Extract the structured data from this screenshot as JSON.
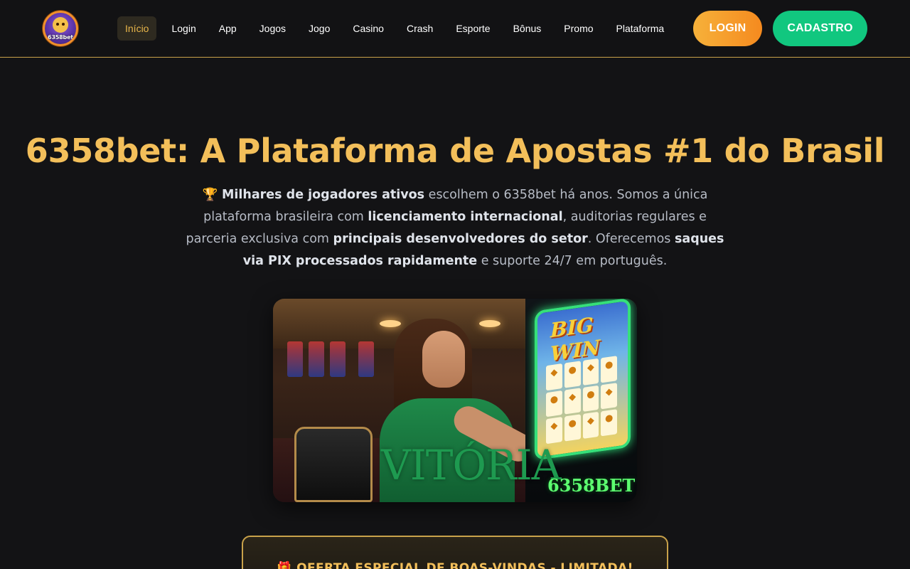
{
  "header": {
    "logo_text": "6358bet",
    "nav": [
      {
        "label": "Início",
        "active": true
      },
      {
        "label": "Login",
        "active": false
      },
      {
        "label": "App",
        "active": false
      },
      {
        "label": "Jogos",
        "active": false
      },
      {
        "label": "Jogo",
        "active": false
      },
      {
        "label": "Casino",
        "active": false
      },
      {
        "label": "Crash",
        "active": false
      },
      {
        "label": "Esporte",
        "active": false
      },
      {
        "label": "Bônus",
        "active": false
      },
      {
        "label": "Promo",
        "active": false
      },
      {
        "label": "Plataforma",
        "active": false
      }
    ],
    "login_label": "LOGIN",
    "register_label": "CADASTRO"
  },
  "hero": {
    "title": "6358bet: A Plataforma de Apostas #1 do Brasil",
    "trophy_icon": "🏆",
    "p1_bold": "Milhares de jogadores ativos",
    "p2": " escolhem o 6358bet há anos. Somos a única plataforma brasileira com ",
    "p3_bold": "licenciamento internacional",
    "p4": ", auditorias regulares e parceria exclusiva com ",
    "p5_bold": "principais desenvolvedores do setor",
    "p6": ". Oferecemos ",
    "p7_bold": "saques via PIX processados rapidamente",
    "p8": " e suporte 24/7 em português."
  },
  "image": {
    "machine_title": "BIG WIN",
    "caption": "VITÓRIA",
    "brand": "6358BET"
  },
  "offer": {
    "gift_icon": "🎁",
    "title": "OFERTA ESPECIAL DE BOAS-VINDAS - LIMITADA!"
  },
  "colors": {
    "accent_gold": "#f3bf5a",
    "login_orange": "#f58a1f",
    "register_green": "#11c77f",
    "background": "#131315"
  }
}
